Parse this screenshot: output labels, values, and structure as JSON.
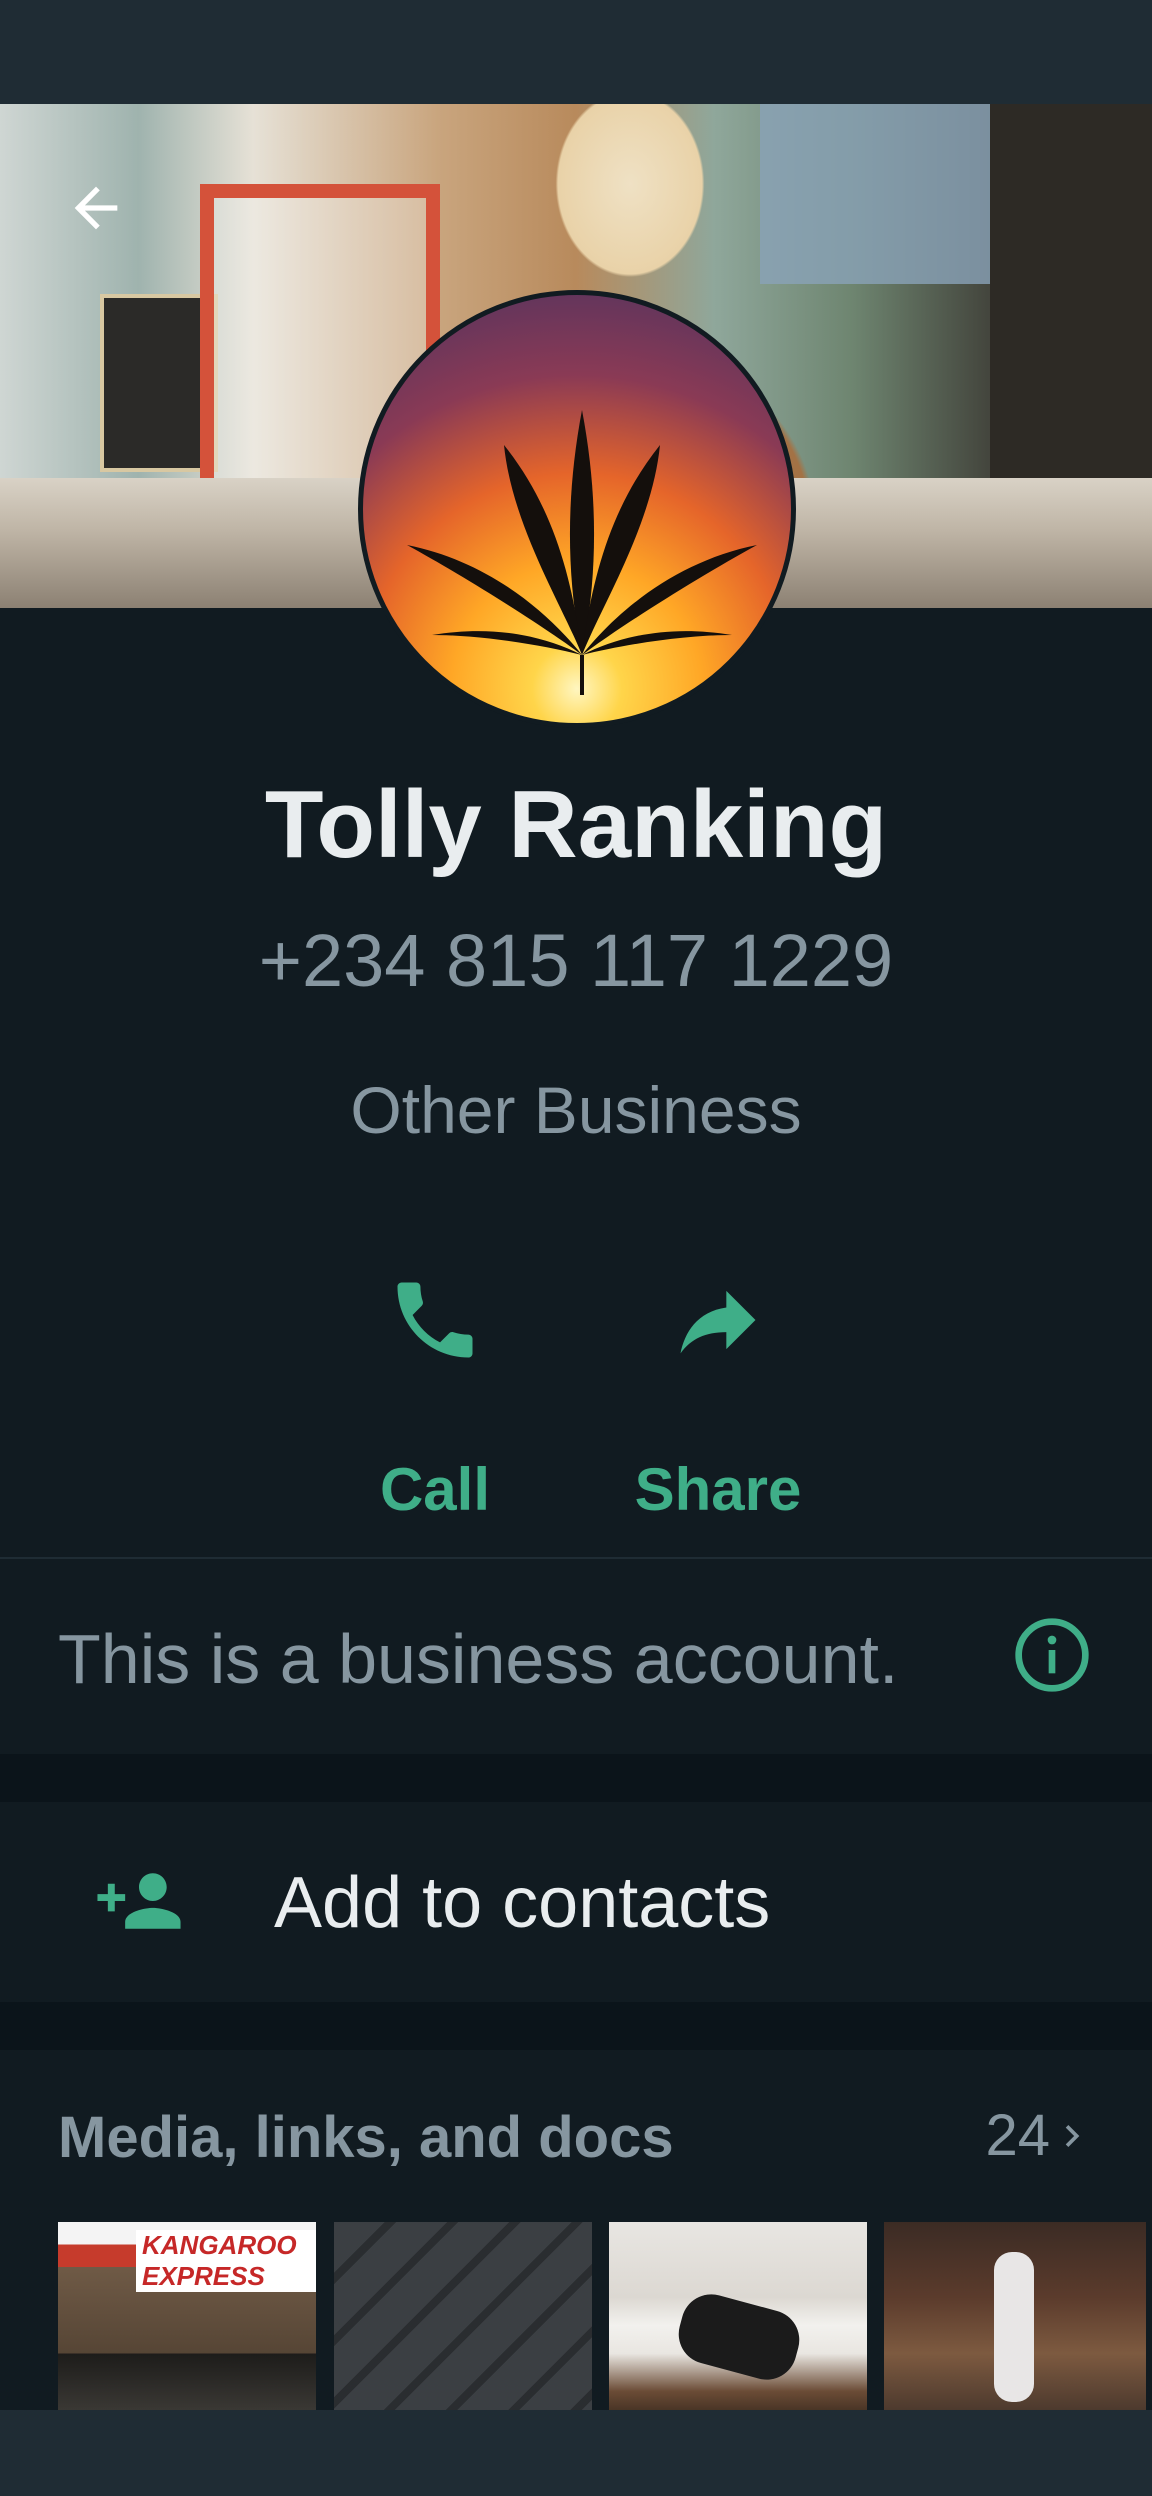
{
  "profile": {
    "name": "Tolly Ranking",
    "phone": "+234 815 117 1229",
    "category": "Other Business"
  },
  "actions": [
    {
      "label": "Call",
      "icon": "phone-icon"
    },
    {
      "label": "Share",
      "icon": "share-icon"
    }
  ],
  "business_note": {
    "text": "This is a business account.",
    "icon": "info-icon"
  },
  "add_contact": {
    "label": "Add to contacts",
    "icon": "person-add-icon"
  },
  "media": {
    "title": "Media, links, and docs",
    "count": "24",
    "thumbnails": [
      {
        "sign_text": "KANGAROO EXPRESS"
      },
      {
        "sign_text": ""
      },
      {
        "sign_text": ""
      },
      {
        "sign_text": ""
      }
    ]
  },
  "colors": {
    "background": "#111b21",
    "accent": "#3fae88",
    "primary_text": "#e9edef",
    "secondary_text": "#8696a0"
  }
}
